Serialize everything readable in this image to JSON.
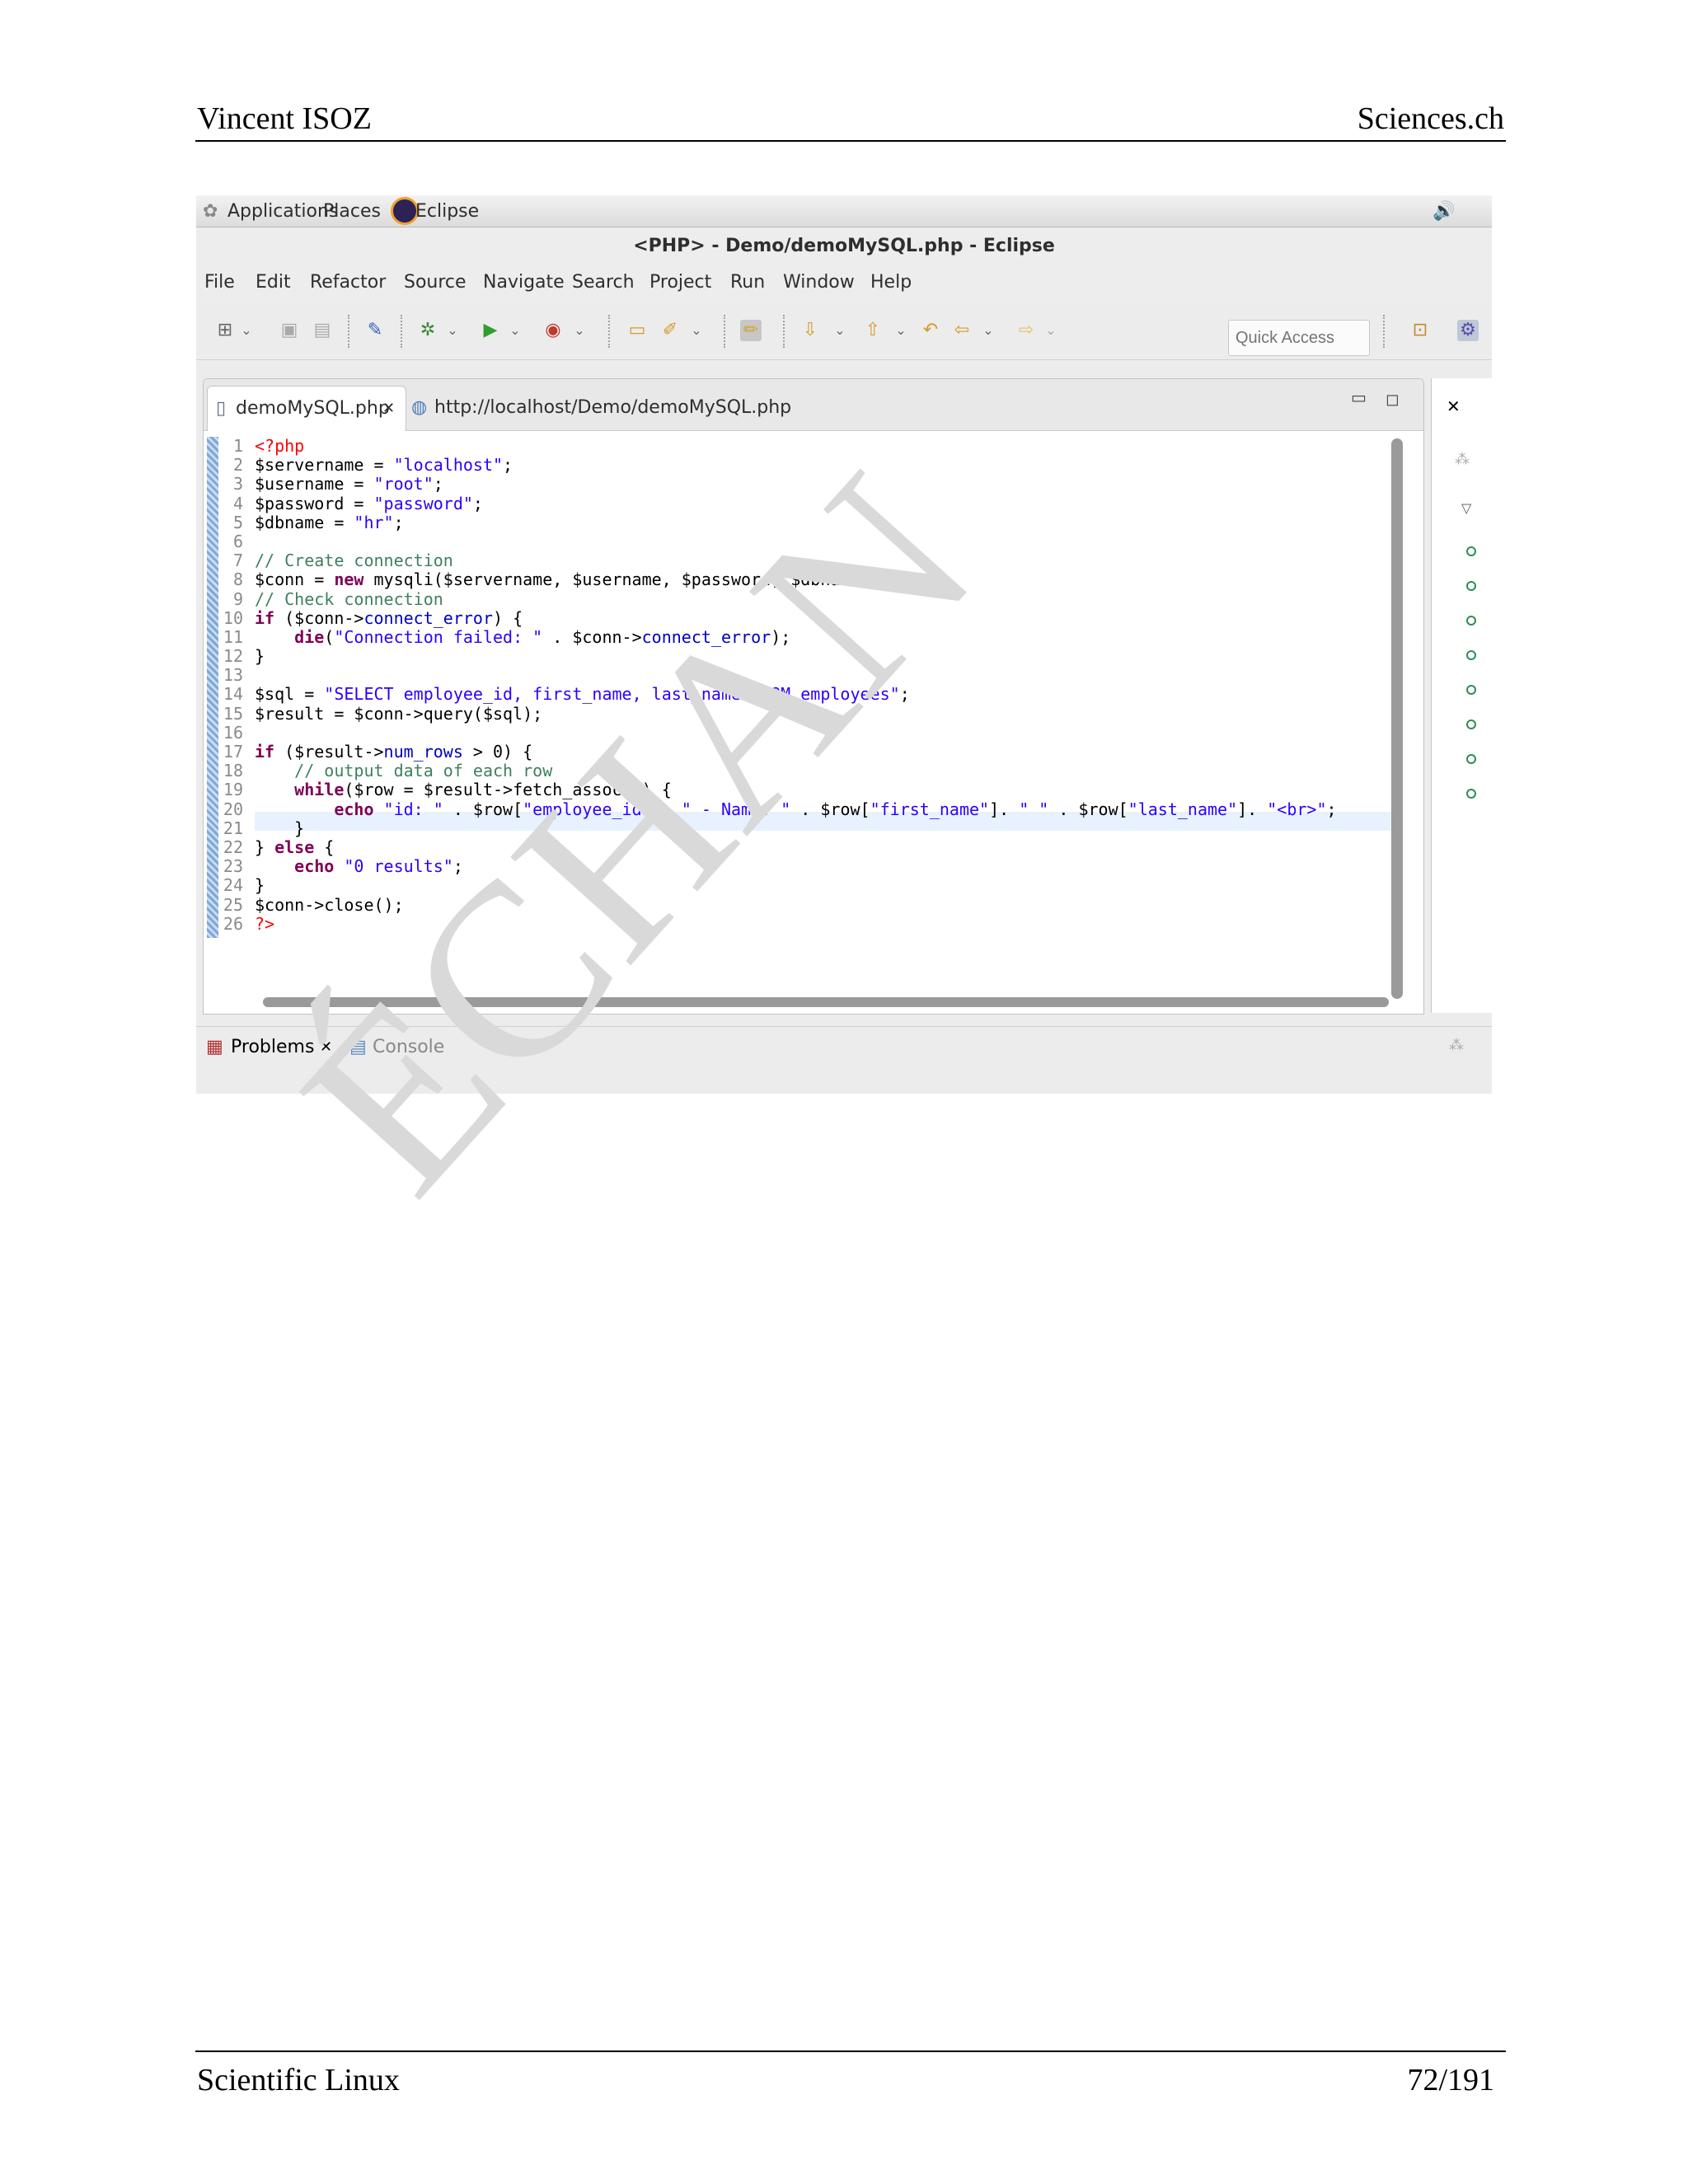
{
  "page": {
    "header_left": "Vincent ISOZ",
    "header_right": "Sciences.ch",
    "footer_left": "Scientific Linux",
    "footer_right": "72/191",
    "watermark": "ÉCHAN"
  },
  "gnome": {
    "applications": "Applications",
    "places": "Places",
    "app_name": "Eclipse"
  },
  "window": {
    "title": "<PHP> - Demo/demoMySQL.php - Eclipse"
  },
  "menu": [
    "File",
    "Edit",
    "Refactor",
    "Source",
    "Navigate",
    "Search",
    "Project",
    "Run",
    "Window",
    "Help"
  ],
  "toolbar": {
    "quick_access_placeholder": "Quick Access"
  },
  "editor": {
    "tabs": [
      {
        "label": "demoMySQL.php"
      },
      {
        "label": "http://localhost/Demo/demoMySQL.php"
      }
    ],
    "line_numbers": [
      "1",
      "2",
      "3",
      "4",
      "5",
      "6",
      "7",
      "8",
      "9",
      "10",
      "11",
      "12",
      "13",
      "14",
      "15",
      "16",
      "17",
      "18",
      "19",
      "20",
      "21",
      "22",
      "23",
      "24",
      "25",
      "26"
    ]
  },
  "views": {
    "problems": "Problems",
    "console": "Console"
  },
  "colors": {
    "keyword": "#7f0055",
    "string": "#2a00ff",
    "comment": "#3f7f5f",
    "php_tag": "#ff0000"
  }
}
